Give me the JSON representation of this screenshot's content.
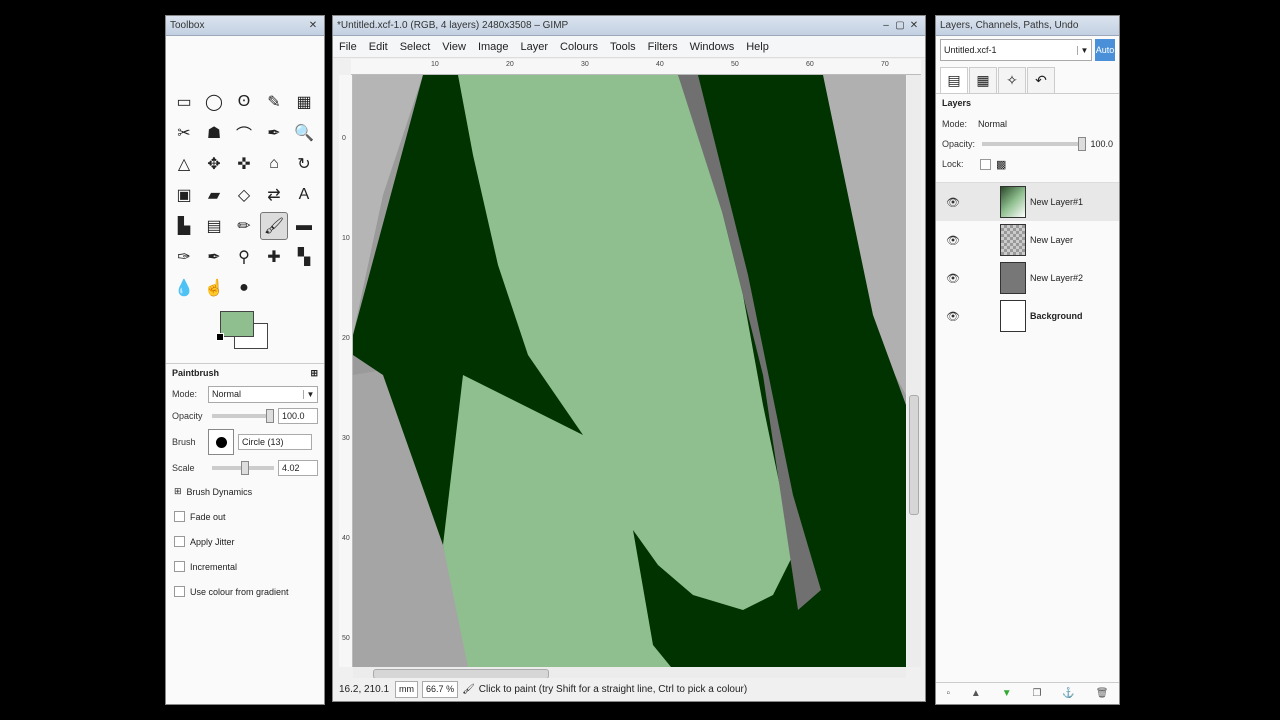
{
  "toolbox": {
    "title": "Toolbox",
    "tools": [
      "rect-select-icon",
      "ellipse-select-icon",
      "free-select-icon",
      "fuzzy-select-icon",
      "color-select-icon",
      "scissors-icon",
      "foreground-select-icon",
      "paths-icon",
      "color-picker-icon",
      "zoom-icon",
      "measure-icon",
      "move-icon",
      "align-icon",
      "crop-icon",
      "rotate-icon",
      "scale-icon",
      "shear-icon",
      "perspective-icon",
      "flip-icon",
      "text-icon",
      "bucket-fill-icon",
      "blend-icon",
      "pencil-icon",
      "paintbrush-icon",
      "eraser-icon",
      "airbrush-icon",
      "ink-icon",
      "clone-icon",
      "heal-icon",
      "perspective-clone-icon",
      "blur-icon",
      "smudge-icon",
      "dodge-burn-icon"
    ],
    "tool_glyphs": [
      "▭",
      "◯",
      "ʘ",
      "✎",
      "▦",
      "✂",
      "☗",
      "⌒",
      "✒",
      "🔍",
      "△",
      "✥",
      "✜",
      "⌂",
      "↻",
      "▣",
      "▰",
      "◇",
      "⇄",
      "A",
      "▙",
      "▤",
      "✏",
      "🖌",
      "▬",
      "✑",
      "✒",
      "⚲",
      "✚",
      "▚",
      "💧",
      "☝",
      "●"
    ],
    "active_tool_index": 23,
    "options": {
      "heading": "Paintbrush",
      "mode_label": "Mode:",
      "mode_value": "Normal",
      "opacity_label": "Opacity",
      "opacity_value": "100.0",
      "brush_label": "Brush",
      "brush_value": "Circle (13)",
      "scale_label": "Scale",
      "scale_value": "4.02",
      "dynamics_label": "Brush Dynamics",
      "checks": [
        "Fade out",
        "Apply Jitter",
        "Incremental",
        "Use colour from gradient"
      ]
    }
  },
  "image_window": {
    "title": "*Untitled.xcf-1.0 (RGB, 4 layers) 2480x3508 – GIMP",
    "menus": [
      "File",
      "Edit",
      "Select",
      "View",
      "Image",
      "Layer",
      "Colours",
      "Tools",
      "Filters",
      "Windows",
      "Help"
    ],
    "ruler_ticks": [
      "10",
      "20",
      "30",
      "40",
      "50",
      "60",
      "70"
    ],
    "vruler_ticks": [
      "0",
      "10",
      "20",
      "30",
      "40",
      "50"
    ],
    "status": {
      "coords": "16.2, 210.1",
      "unit": "mm",
      "zoom": "66.7 %",
      "message": "Click to paint (try Shift for a straight line, Ctrl to pick a colour)"
    }
  },
  "layers_dock": {
    "title": "Layers, Channels, Paths, Undo",
    "image_name": "Untitled.xcf-1",
    "auto_label": "Auto",
    "heading": "Layers",
    "mode_label": "Mode:",
    "mode_value": "Normal",
    "opacity_label": "Opacity:",
    "opacity_value": "100.0",
    "lock_label": "Lock:",
    "layers": [
      {
        "name": "New Layer#1",
        "bold": false,
        "selected": true
      },
      {
        "name": "New Layer",
        "bold": false,
        "selected": false
      },
      {
        "name": "New Layer#2",
        "bold": false,
        "selected": false
      },
      {
        "name": "Background",
        "bold": true,
        "selected": false
      }
    ]
  },
  "colors": {
    "foreground": "#8fbf8f",
    "background": "#ffffff",
    "dark_green": "#003300",
    "light_green": "#8fbf8f"
  }
}
